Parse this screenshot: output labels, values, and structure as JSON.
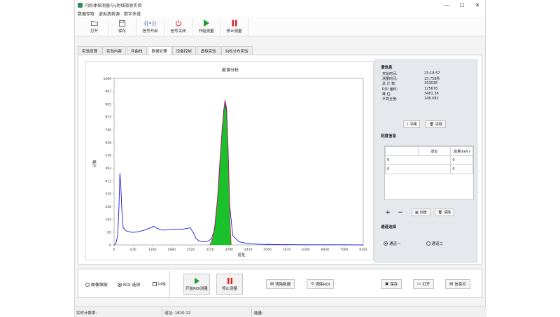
{
  "window": {
    "title": "闪烁体探测器与γ射线吸收实验",
    "controls": [
      "—",
      "☐",
      "✕"
    ]
  },
  "menu": [
    "数据存取",
    "虚拟放射源",
    "数字多道"
  ],
  "toolbar": [
    {
      "label": "打开",
      "icon": "folder-icon"
    },
    {
      "label": "保存",
      "icon": "save-icon"
    },
    {
      "label": "信号开启",
      "icon": "signal-icon"
    },
    {
      "label": "信号关闭",
      "icon": "power-icon"
    },
    {
      "label": "开始测量",
      "icon": "play-icon"
    },
    {
      "label": "停止测量",
      "icon": "pause-icon"
    }
  ],
  "tabs": [
    "实验原理",
    "实验内容",
    "坪曲线",
    "数据处理",
    "设备控制",
    "虚拟实验",
    "泊松分布实验"
  ],
  "active_tab": 3,
  "chart_data": {
    "type": "line",
    "title": "能谱分析",
    "xlabel": "道址",
    "ylabel": "计数",
    "xlim": [
      0,
      8191
    ],
    "ylim": [
      0,
      1069
    ],
    "x_ticks": [
      "0",
      "630",
      "1260",
      "1890",
      "2520",
      "3150",
      "3780",
      "4410",
      "5040",
      "5670",
      "6300",
      "6930",
      "7560",
      "8191"
    ],
    "y_ticks": [
      "0",
      "82",
      "164",
      "246",
      "329",
      "411",
      "493",
      "576",
      "658",
      "740",
      "823",
      "905",
      "987",
      "1069"
    ],
    "series": [
      {
        "color": "#1a1adf",
        "x": [
          10,
          60,
          120,
          160,
          190,
          220,
          260,
          300,
          400,
          600,
          800,
          1000,
          1200,
          1300,
          1400,
          1500,
          1600,
          1800,
          2000,
          2200,
          2400,
          2500,
          2600,
          2700,
          2800,
          2900,
          3000,
          3100,
          3200,
          3300,
          3400,
          3500,
          3600,
          3650,
          3700,
          3750,
          3800,
          3900,
          4100,
          4400,
          4800,
          5500,
          6500,
          7500,
          8191
        ],
        "y": [
          0,
          10,
          60,
          250,
          460,
          380,
          200,
          110,
          90,
          80,
          85,
          95,
          110,
          120,
          108,
          100,
          95,
          98,
          102,
          100,
          105,
          110,
          80,
          40,
          25,
          22,
          20,
          25,
          40,
          100,
          300,
          600,
          860,
          930,
          850,
          600,
          250,
          60,
          20,
          8,
          4,
          2,
          1,
          1,
          0
        ]
      },
      {
        "color": "#e5202a",
        "x": [
          3150,
          3250,
          3350,
          3450,
          3550,
          3650,
          3700,
          3750,
          3800,
          3850
        ],
        "y": [
          0,
          50,
          180,
          420,
          750,
          930,
          880,
          600,
          200,
          0
        ]
      }
    ],
    "roi": {
      "color": "#19c22a",
      "x_start": 3150,
      "x_end": 3850
    }
  },
  "info": {
    "title": "谱信息",
    "rows": [
      {
        "k": "开始时间:",
        "v": "23:18:57"
      },
      {
        "k": "测量时间:",
        "v": "15.758秒"
      },
      {
        "k": "总 计 数:",
        "v": "333036"
      },
      {
        "k": "ROI 面积:",
        "v": "125676"
      },
      {
        "k": "峰     位:",
        "v": "3481.36"
      },
      {
        "k": "半高全宽:",
        "v": "148.082"
      }
    ],
    "find_peak": "寻峰",
    "clear": "清除"
  },
  "calib": {
    "title": "刻度信息",
    "headers": [
      "道址",
      "能量(keV)"
    ],
    "rows": [
      [
        "0",
        "0"
      ],
      [
        "0",
        "0"
      ]
    ],
    "add": "+",
    "remove": "−",
    "scale": "刻度",
    "clear": "清除"
  },
  "channel": {
    "title": "通道选择",
    "opt1": "通道一",
    "opt2": "通道二"
  },
  "bottom": {
    "zoom": "图像缩放",
    "roi_select": "ROI 选择",
    "log": "Log",
    "start_roi": "开始ROI测量",
    "stop": "停止测量",
    "clear_data": "清除数据",
    "clear_roi": "清除ROI",
    "save": "保存",
    "open": "打开",
    "info": "信息栏"
  },
  "status": {
    "realtime": "实时计数率:",
    "channel": "道址: 1820.22",
    "energy": "能量:"
  }
}
